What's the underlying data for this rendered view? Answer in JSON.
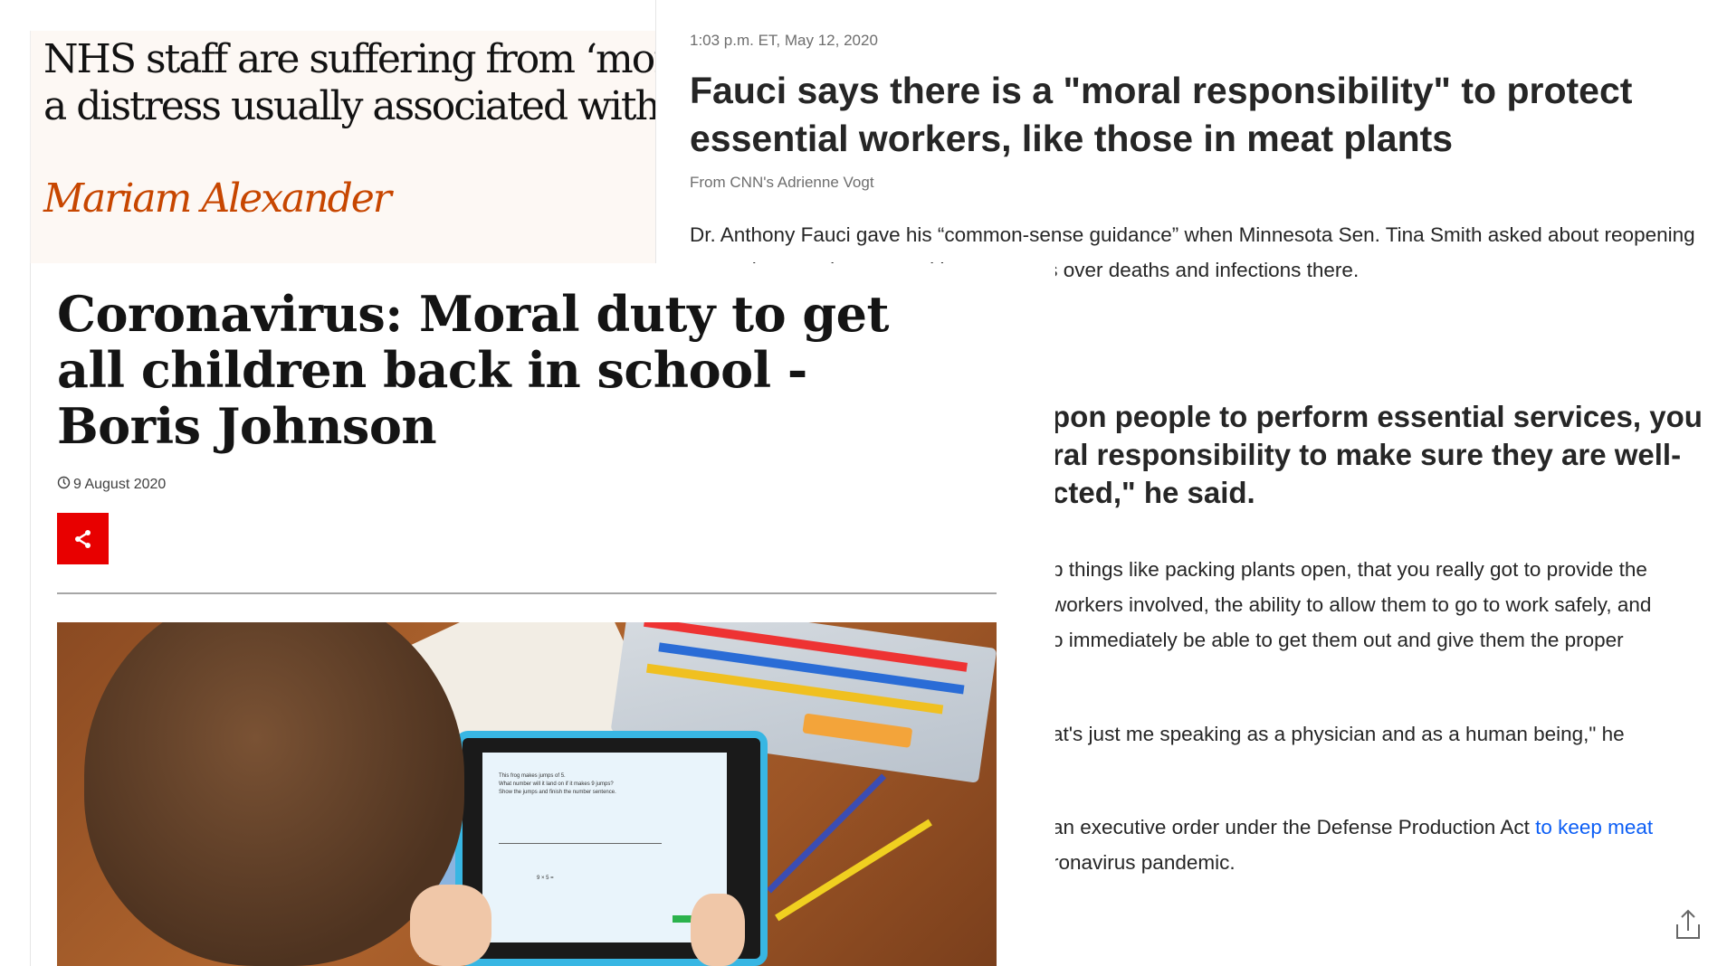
{
  "guardian": {
    "headline": "NHS staff are suffering from ‘moral injury’, a distress usually associated with war zones",
    "author": "Mariam Alexander"
  },
  "cnn": {
    "timestamp": "1:03 p.m. ET, May 12, 2020",
    "headline": "Fauci says there is a \"moral responsibility\" to protect essential workers, like those in meat plants",
    "byline": "From CNN's Adrienne Vogt",
    "para1": "Dr. Anthony Fauci gave his “common-sense guidance” when Minnesota Sen. Tina Smith asked about reopening meat plants and expressed her concerns over deaths and infections there.",
    "quote_lines": [
      "pon people to perform essential services, you",
      "ral responsibility to make sure they are well-",
      "cted,\" he said."
    ],
    "body_lines": [
      "p things like packing plants open, that you really got to provide the",
      "workers involved, the ability to allow them to go to work safely, and",
      "o immediately be able to get them out and give them the proper"
    ],
    "body2": "at's just me speaking as a physician and as a human being,\" he",
    "body3_pre": "an executive order under the Defense Production Act ",
    "body3_link": "to keep meat",
    "body4": "ronavirus pandemic."
  },
  "bbc": {
    "headline": "Coronavirus: Moral duty to get all children back in school - Boris Johnson",
    "date": "9 August 2020",
    "tablet_lines": [
      "This frog makes jumps of 5.",
      "What number will it land on if it makes 9 jumps?",
      "Show the jumps and finish the number sentence."
    ],
    "tablet_eq": "9 × 5 ="
  },
  "colors": {
    "bbc_red": "#e80000",
    "guardian_author": "#c74600",
    "link": "#0c5ef5"
  }
}
